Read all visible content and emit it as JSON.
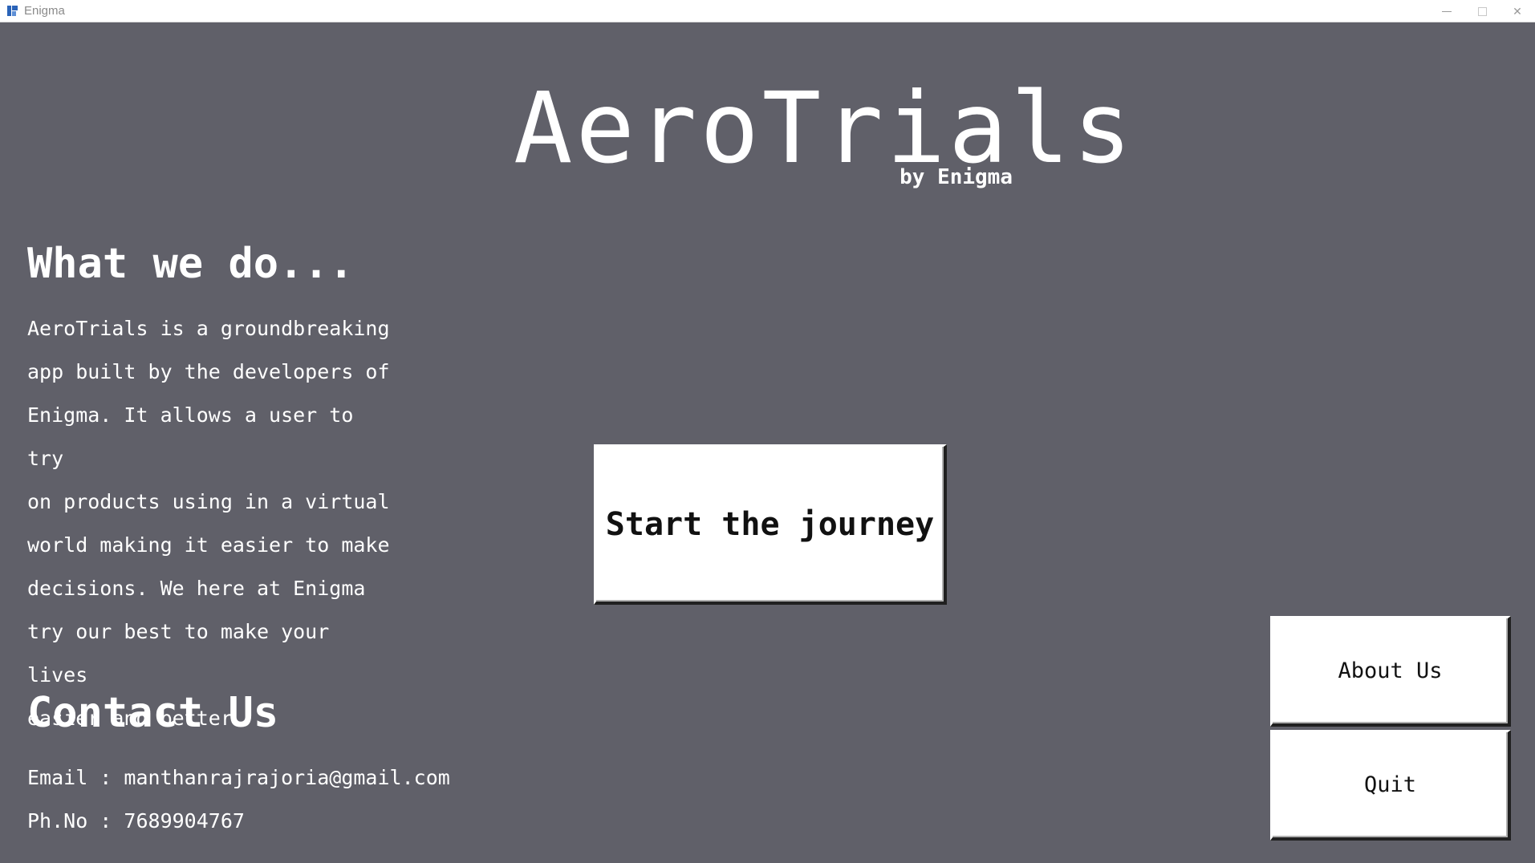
{
  "window": {
    "title": "Enigma",
    "icon": "app-icon",
    "controls": [
      "minimize",
      "maximize",
      "close"
    ]
  },
  "hero": {
    "title": "AeroTrials",
    "subtitle": "by Enigma"
  },
  "about_section": {
    "heading": "What we do...",
    "lines": [
      "AeroTrials is a groundbreaking",
      "app built by the developers of",
      "Enigma. It allows a user to try",
      "on products using in a virtual",
      "world making it easier to make",
      "decisions. We here at Enigma",
      "try our best to make your lives",
      "easier and better"
    ]
  },
  "contact_section": {
    "heading": "Contact Us",
    "email": "Email : manthanrajrajoria@gmail.com",
    "phone": "Ph.No : 7689904767"
  },
  "buttons": {
    "start": "Start the journey",
    "about": "About Us",
    "quit": "Quit"
  },
  "colors": {
    "background": "#606069",
    "text": "#ffffff",
    "button_bg": "#ffffff",
    "button_text": "#111111"
  }
}
